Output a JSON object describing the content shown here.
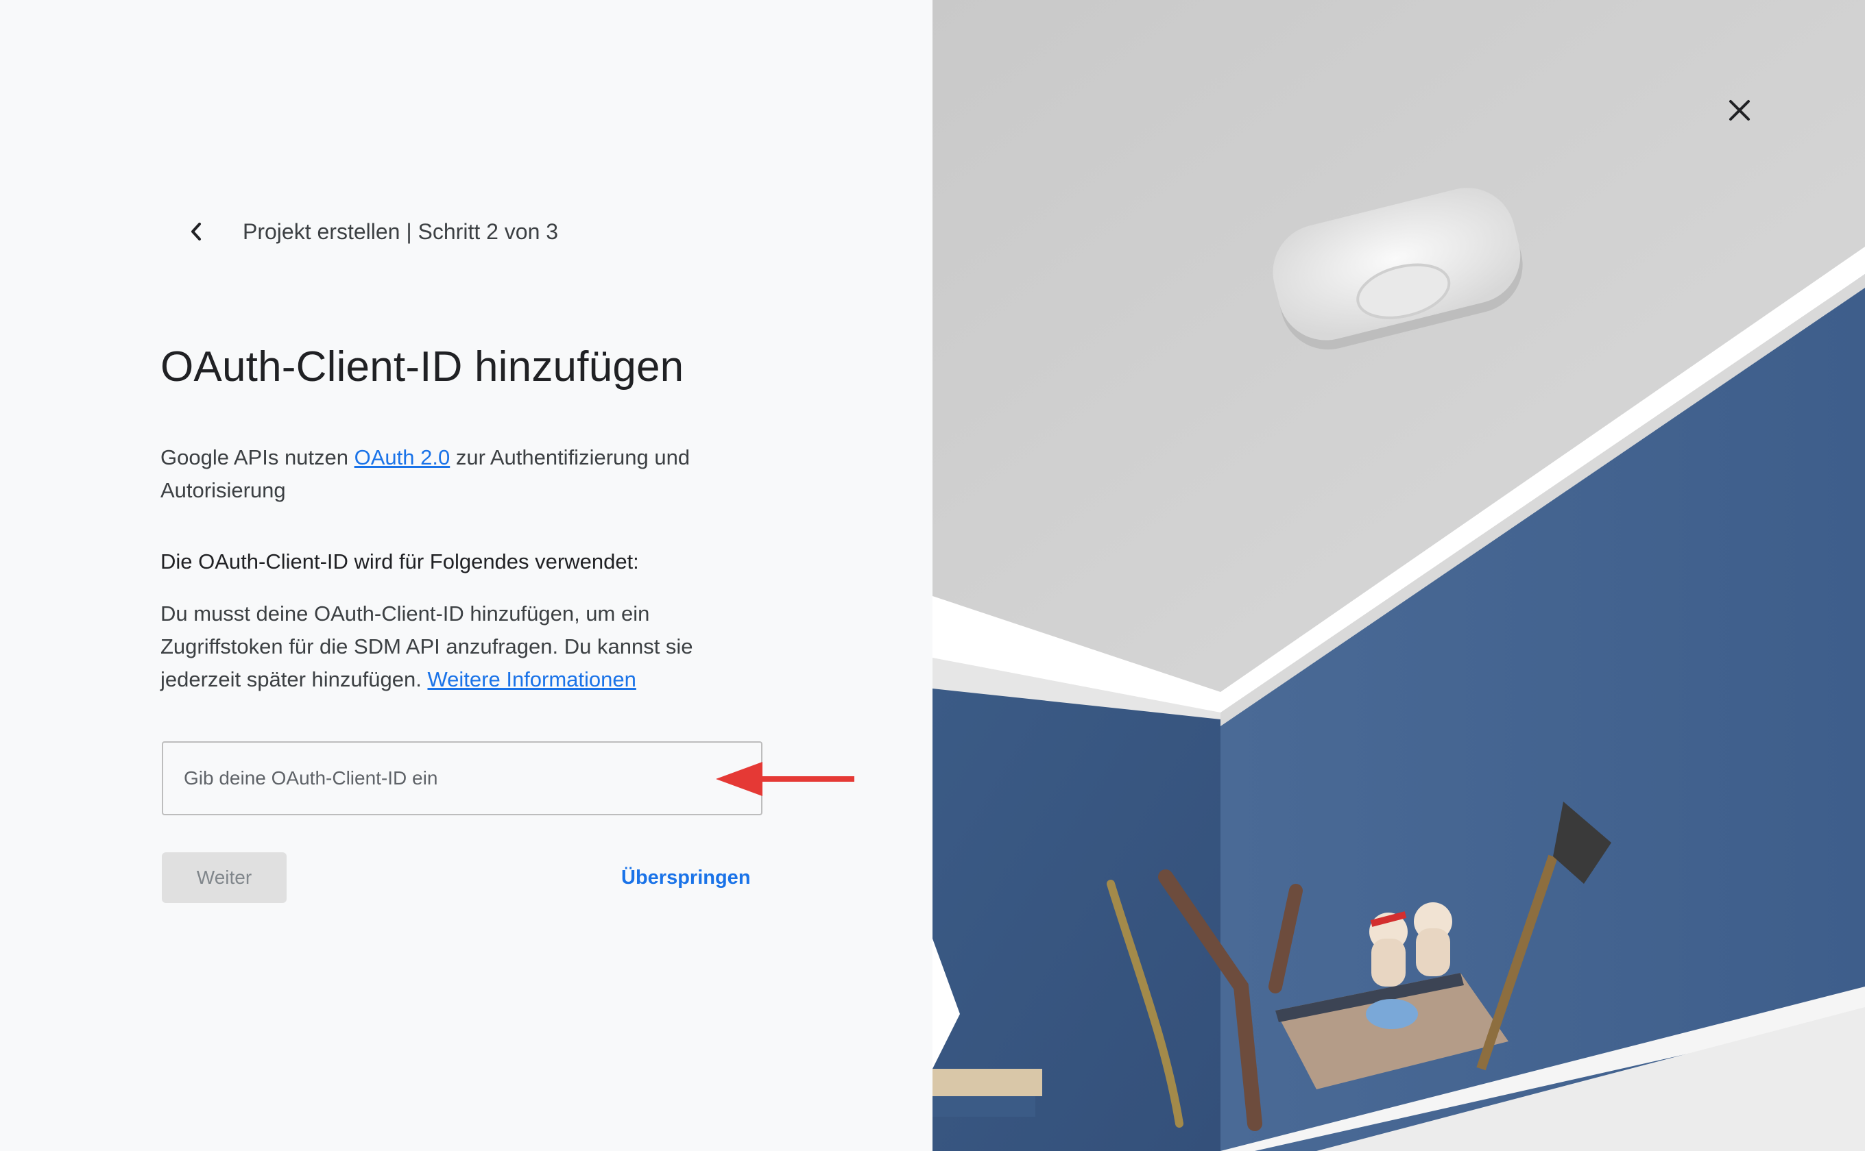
{
  "header": {
    "breadcrumb": "Projekt erstellen | Schritt 2 von 3"
  },
  "main": {
    "title": "OAuth-Client-ID hinzufügen",
    "intro": {
      "before_link": "Google APIs nutzen ",
      "link": "OAuth 2.0",
      "after_link": " zur Authentifizierung und Autorisierung"
    },
    "usage_heading": "Die OAuth-Client-ID wird für Folgendes verwendet:",
    "usage_body": {
      "text": "Du musst deine OAuth-Client-ID hinzufügen, um ein Zugriffstoken für die SDM API anzufragen. Du kannst sie jederzeit später hinzufügen. ",
      "link": "Weitere Informationen"
    },
    "client_id_input": {
      "placeholder": "Gib deine OAuth-Client-ID ein",
      "value": ""
    },
    "next_button": "Weiter",
    "skip_button": "Überspringen"
  },
  "icons": {
    "back": "chevron-left-icon",
    "close": "close-icon",
    "annotation": "red-arrow-left"
  },
  "colors": {
    "link": "#1a73e8",
    "annotation_arrow": "#e53935",
    "disabled_button_bg": "#e0e0e0",
    "wall": "#3f5f8c",
    "ceiling": "#d2d2d2"
  }
}
